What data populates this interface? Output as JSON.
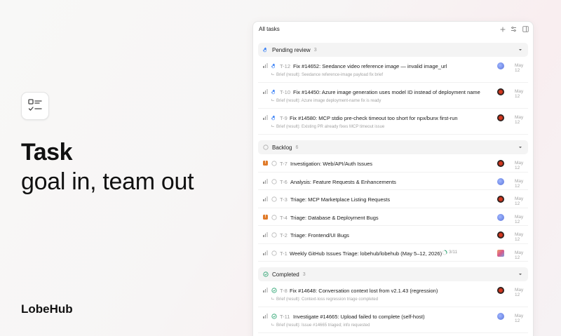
{
  "hero": {
    "title": "Task",
    "subtitle": "goal in, team out",
    "brand": "LobeHub"
  },
  "panel": {
    "title": "All tasks",
    "header_buttons": [
      "plus-icon",
      "filter-icon",
      "panel-toggle-icon"
    ]
  },
  "groups": [
    {
      "label": "Pending review",
      "count": "3",
      "status": "pending",
      "tasks": [
        {
          "id": "T-12",
          "title": "Fix #14652: Seedance video reference image — invalid image_url",
          "brief": "Brief (result): Seedance reference-image payload fix brief",
          "date": "May 12",
          "avatar": "blue",
          "priority": "medium"
        },
        {
          "id": "T-10",
          "title": "Fix #14450: Azure image generation uses model ID instead of deployment name",
          "brief": "Brief (result): Azure image deployment-name fix is ready",
          "date": "May 12",
          "avatar": "dark",
          "priority": "medium"
        },
        {
          "id": "T-9",
          "title": "Fix #14580: MCP stdio pre-check timeout too short for npx/bunx first-run",
          "brief": "Brief (result): Existing PR already fixes MCP timeout issue",
          "date": "May 12",
          "avatar": "dark",
          "priority": "medium"
        }
      ]
    },
    {
      "label": "Backlog",
      "count": "6",
      "status": "backlog",
      "tasks": [
        {
          "id": "T-7",
          "title": "Investigation: Web/API/Auth Issues",
          "date": "May 12",
          "avatar": "dark",
          "priority": "urgent"
        },
        {
          "id": "T-6",
          "title": "Analysis: Feature Requests & Enhancements",
          "date": "May 12",
          "avatar": "blue",
          "priority": "medium"
        },
        {
          "id": "T-3",
          "title": "Triage: MCP Marketplace Listing Requests",
          "date": "May 12",
          "avatar": "dark",
          "priority": "medium"
        },
        {
          "id": "T-4",
          "title": "Triage: Database & Deployment Bugs",
          "date": "May 12",
          "avatar": "blue",
          "priority": "urgent"
        },
        {
          "id": "T-2",
          "title": "Triage: Frontend/UI Bugs",
          "date": "May 12",
          "avatar": "dark",
          "priority": "medium"
        },
        {
          "id": "T-1",
          "title": "Weekly GitHub Issues Triage: lobehub/lobehub (May 5–12, 2026)",
          "progress": "3/11",
          "date": "May 12",
          "avatar": "multi",
          "priority": "medium"
        }
      ]
    },
    {
      "label": "Completed",
      "count": "3",
      "status": "completed",
      "tasks": [
        {
          "id": "T-8",
          "title": "Fix #14648: Conversation context lost from v2.1.43 (regression)",
          "brief": "Brief (result): Context-loss regression triage completed",
          "date": "May 12",
          "avatar": "dark",
          "priority": "medium"
        },
        {
          "id": "T-11",
          "title": "Investigate #14665: Upload failed to complete (self-host)",
          "brief": "Brief (result): Issue #14665 triaged; info requested",
          "date": "May 12",
          "avatar": "blue",
          "priority": "medium"
        }
      ]
    }
  ],
  "colors": {
    "pending": "#3b82f6",
    "completed": "#22a06b",
    "urgent": "#e07b2a",
    "accent_text": "#1a1a1a"
  }
}
